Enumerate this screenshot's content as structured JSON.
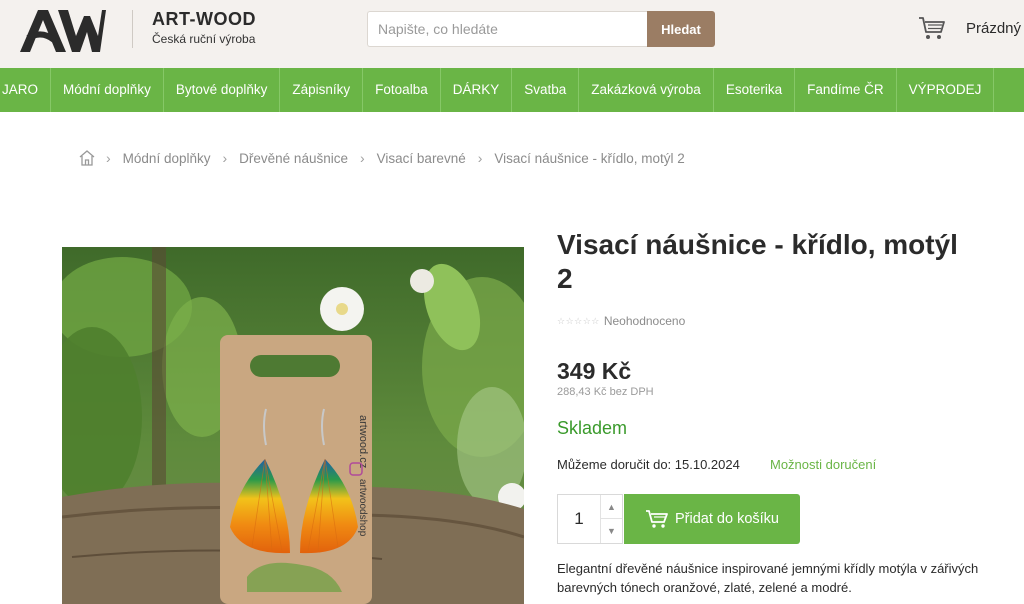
{
  "header": {
    "brand_name": "ART-WOOD",
    "brand_subtitle": "Česká ruční výroba",
    "search_placeholder": "Napište, co hledáte",
    "search_button": "Hledat",
    "cart_label": "Prázdný"
  },
  "nav": {
    "items": [
      "JARO",
      "Módní doplňky",
      "Bytové doplňky",
      "Zápisníky",
      "Fotoalba",
      "DÁRKY",
      "Svatba",
      "Zakázková výroba",
      "Esoterika",
      "Fandíme ČR",
      "VÝPRODEJ"
    ]
  },
  "breadcrumb": {
    "items": [
      "Módní doplňky",
      "Dřevěné náušnice",
      "Visací barevné",
      "Visací náušnice - křídlo, motýl 2"
    ]
  },
  "product": {
    "title": "Visací náušnice - křídlo, motýl 2",
    "rating_text": "Neohodnoceno",
    "stars": "☆☆☆☆☆",
    "price": "349 Kč",
    "price_without_vat": "288,43 Kč bez DPH",
    "stock": "Skladem",
    "delivery": "Můžeme doručit do: 15.10.2024",
    "delivery_options": "Možnosti doručení",
    "quantity": "1",
    "add_to_cart": "Přidat do košíku",
    "description": "Elegantní dřevěné náušnice inspirované jemnými křídly motýla v zářivých barevných tónech oranžové, zlaté, zelené a modré.",
    "card_text": "artwood.cz",
    "card_social": "artwoodshop"
  },
  "colors": {
    "accent_green": "#6ab546",
    "stock_green": "#3a9a2b",
    "search_button": "#9b7d64",
    "header_bg": "#f4f1ee"
  },
  "icons": {
    "cart": "cart-icon",
    "home": "home-icon",
    "chevron": "chevron-right-icon"
  }
}
